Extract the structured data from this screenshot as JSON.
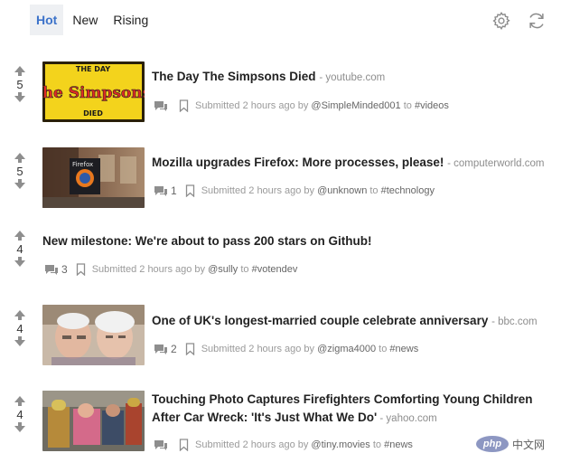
{
  "tabs": [
    {
      "label": "Hot",
      "active": true
    },
    {
      "label": "New",
      "active": false
    },
    {
      "label": "Rising",
      "active": false
    }
  ],
  "toolbar": {
    "settings_icon": "gear-icon",
    "refresh_icon": "refresh-icon"
  },
  "posts": [
    {
      "score": "5",
      "title": "The Day The Simpsons Died",
      "domain": "youtube.com",
      "comment_count": "",
      "submitted": "Submitted 2 hours ago by",
      "user": "@SimpleMinded001",
      "to": "to",
      "sub": "#videos",
      "thumb_caption_top": "THE DAY",
      "thumb_caption_mid": "the Simpsons",
      "thumb_caption_bot": "DIED"
    },
    {
      "score": "5",
      "title": "Mozilla upgrades Firefox: More processes, please!",
      "domain": "computerworld.com",
      "comment_count": "1",
      "submitted": "Submitted 2 hours ago by",
      "user": "@unknown",
      "to": "to",
      "sub": "#technology",
      "thumb_caption_top": "Firefox"
    },
    {
      "score": "4",
      "title": "New milestone: We're about to pass 200 stars on Github!",
      "domain": "",
      "comment_count": "3",
      "submitted": "Submitted 2 hours ago by",
      "user": "@sully",
      "to": "to",
      "sub": "#votendev"
    },
    {
      "score": "4",
      "title": "One of UK's longest-married couple celebrate anniversary",
      "domain": "bbc.com",
      "comment_count": "2",
      "submitted": "Submitted 2 hours ago by",
      "user": "@zigma4000",
      "to": "to",
      "sub": "#news"
    },
    {
      "score": "4",
      "title_line1": "Touching Photo Captures Firefighters Comforting Young Children",
      "title_line2": "After Car Wreck: 'It's Just What We Do'",
      "domain": "yahoo.com",
      "comment_count": "",
      "submitted": "Submitted 2 hours ago by",
      "user": "@tiny.movies",
      "to": "to",
      "sub": "#news"
    }
  ],
  "watermark": {
    "badge": "php",
    "text": "中文网"
  },
  "colors": {
    "accent": "#3d73ca",
    "tab_active_bg": "#eef0f3",
    "muted": "#9a9a9a",
    "arrow": "#8e8e8e"
  }
}
